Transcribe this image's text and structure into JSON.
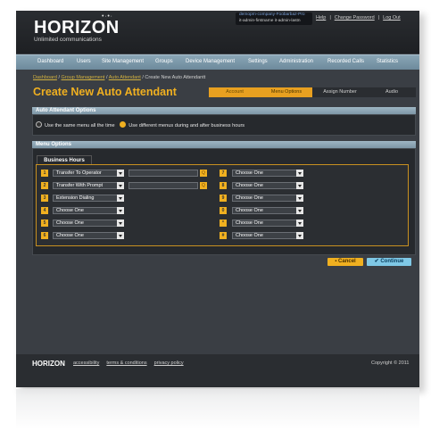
{
  "header": {
    "logo": "HORIZON",
    "tagline": "Unlimited communications",
    "account_line1": "demoprn-company-Foobarbaz-Pro",
    "account_line2": "it-admin-firstname it-admin-lastn",
    "links": [
      "Help",
      "Change Password",
      "Log Out"
    ]
  },
  "nav": [
    "Dashboard",
    "Users",
    "Site Management",
    "Groups",
    "Device Management",
    "Settings",
    "Administration",
    "Recorded Calls",
    "Statistics"
  ],
  "breadcrumb": [
    "Dashboard",
    "Group Management",
    "Auto Attendant",
    "Create New Auto Attendantt"
  ],
  "page_title": "Create New Auto Attendant",
  "steps": [
    "Account",
    "Menu Options",
    "Assign Number",
    "Audio"
  ],
  "auto_attendant_options": {
    "title": "Auto Attendant Options",
    "option_same": "Use the same menu all the time",
    "option_different": "Use different menus during and after business hours"
  },
  "menu_options": {
    "title": "Menu Options",
    "tab": "Business Hours",
    "left": [
      {
        "n": "1",
        "value": "Transfer To Operator"
      },
      {
        "n": "2",
        "value": "Transfer With Prompt"
      },
      {
        "n": "3",
        "value": "Extension Dialing"
      },
      {
        "n": "4",
        "value": "Choose One"
      },
      {
        "n": "5",
        "value": "Choose One"
      },
      {
        "n": "6",
        "value": "Choose One"
      }
    ],
    "right": [
      {
        "n": "7",
        "value": "Choose One"
      },
      {
        "n": "8",
        "value": "Choose One"
      },
      {
        "n": "9",
        "value": "Choose One"
      },
      {
        "n": "0",
        "value": "Choose One"
      },
      {
        "n": "*",
        "value": "Choose One"
      },
      {
        "n": "#",
        "value": "Choose One"
      }
    ]
  },
  "buttons": {
    "cancel": "Cancel",
    "continue": "Continue"
  },
  "footer": {
    "logo": "HORIZON",
    "links": [
      "accessibility",
      "terms & conditions",
      "privacy policy"
    ],
    "copyright": "Copyright © 2011"
  }
}
